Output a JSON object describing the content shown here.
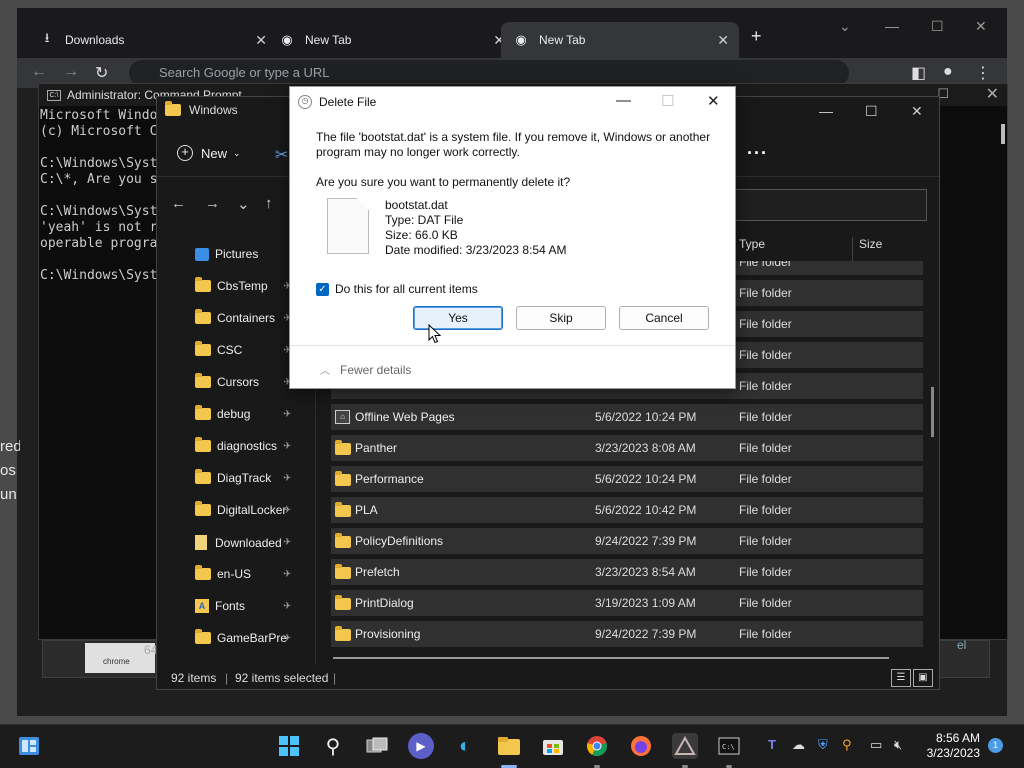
{
  "chrome": {
    "tabs": [
      {
        "label": "Downloads"
      },
      {
        "label": "New Tab"
      },
      {
        "label": "New Tab"
      }
    ],
    "omnibox_placeholder": "Search Google or type a URL"
  },
  "cmd": {
    "title": "Administrator: Command Prompt",
    "lines": [
      "Microsoft Windo",
      "(c) Microsoft C",
      "",
      "C:\\Windows\\Syst",
      "C:\\*, Are you s",
      "",
      "C:\\Windows\\Syst",
      "'yeah' is not r",
      "operable progra",
      "",
      "C:\\Windows\\Syst"
    ]
  },
  "background_fragments": [
    "red",
    "os",
    "un"
  ],
  "ghost": {
    "number": "64",
    "thumb_text": "chrome",
    "right_text": "el"
  },
  "explorer": {
    "title": "Windows",
    "new_label": "New",
    "columns": {
      "type": "Type",
      "size": "Size"
    },
    "sidebar": [
      {
        "label": "Pictures",
        "icon": "pictures-icon",
        "pinned": true
      },
      {
        "label": "CbsTemp",
        "icon": "folder-icon",
        "pinned": true
      },
      {
        "label": "Containers",
        "icon": "folder-icon",
        "pinned": true
      },
      {
        "label": "CSC",
        "icon": "folder-icon",
        "pinned": true
      },
      {
        "label": "Cursors",
        "icon": "folder-icon",
        "pinned": true
      },
      {
        "label": "debug",
        "icon": "folder-icon",
        "pinned": true
      },
      {
        "label": "diagnostics",
        "icon": "folder-icon",
        "pinned": true
      },
      {
        "label": "DiagTrack",
        "icon": "folder-icon",
        "pinned": true
      },
      {
        "label": "DigitalLocker",
        "icon": "folder-icon",
        "pinned": true
      },
      {
        "label": "Downloaded",
        "icon": "document-icon",
        "pinned": true
      },
      {
        "label": "en-US",
        "icon": "folder-icon",
        "pinned": true
      },
      {
        "label": "Fonts",
        "icon": "fonts-icon",
        "pinned": true
      },
      {
        "label": "GameBarPre",
        "icon": "folder-icon",
        "pinned": true
      }
    ],
    "files": [
      {
        "name": "",
        "date": "",
        "type": "File folder"
      },
      {
        "name": "",
        "date": "",
        "type": "File folder"
      },
      {
        "name": "",
        "date": "",
        "type": "File folder"
      },
      {
        "name": "",
        "date": "",
        "type": "File folder"
      },
      {
        "name": "",
        "date": "",
        "type": "File folder"
      },
      {
        "name": "Offline Web Pages",
        "date": "5/6/2022 10:24 PM",
        "type": "File folder"
      },
      {
        "name": "Panther",
        "date": "3/23/2023 8:08 AM",
        "type": "File folder"
      },
      {
        "name": "Performance",
        "date": "5/6/2022 10:24 PM",
        "type": "File folder"
      },
      {
        "name": "PLA",
        "date": "5/6/2022 10:42 PM",
        "type": "File folder"
      },
      {
        "name": "PolicyDefinitions",
        "date": "9/24/2022 7:39 PM",
        "type": "File folder"
      },
      {
        "name": "Prefetch",
        "date": "3/23/2023 8:54 AM",
        "type": "File folder"
      },
      {
        "name": "PrintDialog",
        "date": "3/19/2023 1:09 AM",
        "type": "File folder"
      },
      {
        "name": "Provisioning",
        "date": "9/24/2022 7:39 PM",
        "type": "File folder"
      }
    ],
    "status": {
      "items": "92 items",
      "selected": "92 items selected"
    }
  },
  "dialog": {
    "title": "Delete File",
    "message": "The file 'bootstat.dat' is a system file. If you remove it, Windows or another program may no longer work correctly.",
    "question": "Are you sure you want to permanently delete it?",
    "file": {
      "name": "bootstat.dat",
      "type": "Type: DAT File",
      "size": "Size: 66.0 KB",
      "modified": "Date modified: 3/23/2023 8:54 AM"
    },
    "checkbox_label": "Do this for all current items",
    "checkbox_checked": true,
    "buttons": {
      "yes": "Yes",
      "skip": "Skip",
      "cancel": "Cancel"
    },
    "fewer_details": "Fewer details"
  },
  "taskbar": {
    "time": "8:56 AM",
    "date": "3/23/2023",
    "notifications": "1"
  }
}
